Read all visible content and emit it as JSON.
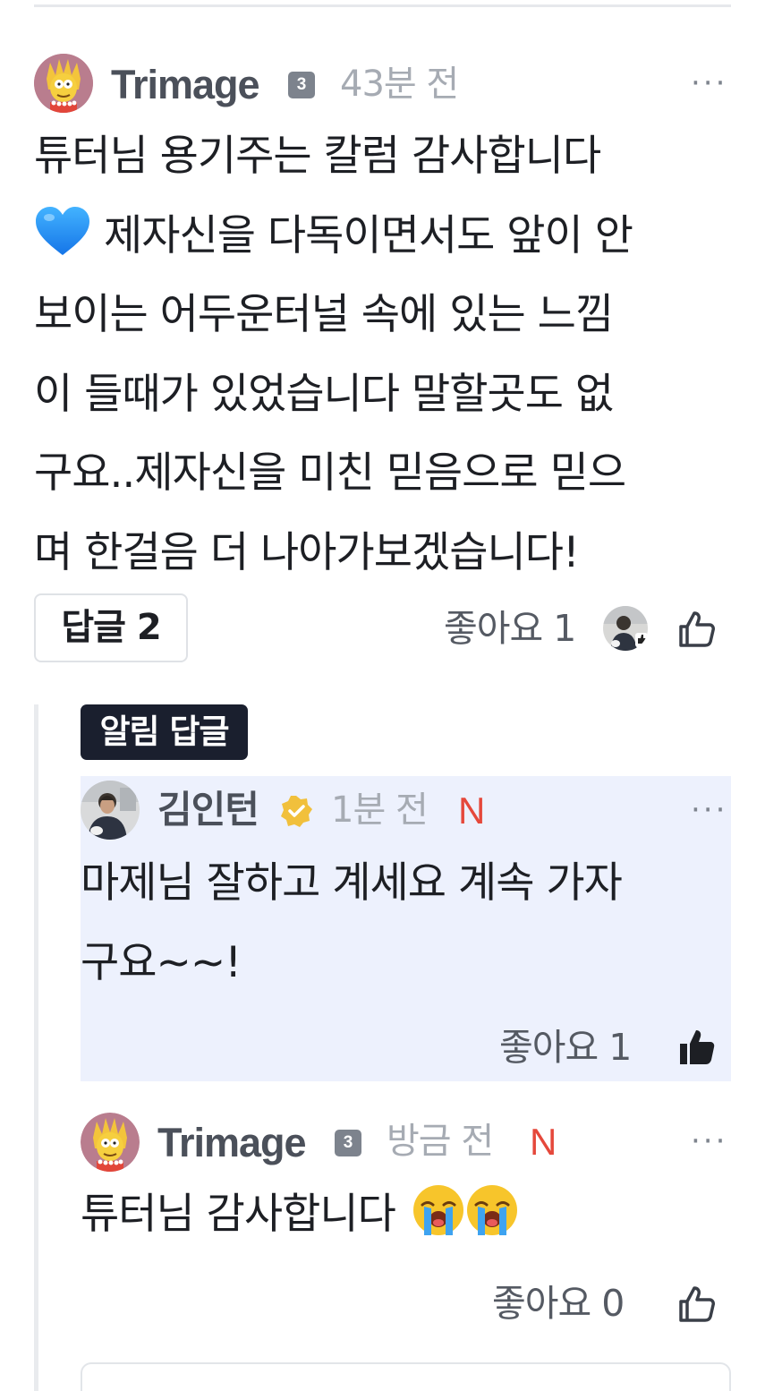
{
  "comment": {
    "author": "Trimage",
    "level": "3",
    "time": "43분 전",
    "more": "···",
    "lines": [
      "튜터님 용기주는 칼럼 감사합니다",
      "제자신을 다독이면서도 앞이 안",
      "보이는 어두운터널 속에 있는 느낌",
      "이 들때가 있었습니다 말할곳도 없",
      "구요..제자신을 미친 믿음으로 믿으",
      "며 한걸음 더 나아가보겠습니다!"
    ],
    "heart_icon": "blue-heart-icon",
    "reply_button": "답글 2",
    "like_label": "좋아요 1"
  },
  "notice_reply_tag": "알림 답글",
  "reply1": {
    "author": "김인턴",
    "time": "1분 전",
    "new_badge": "N",
    "more": "···",
    "lines": [
      "마제님 잘하고 계세요 계속 가자",
      "구요~~!"
    ],
    "like_label": "좋아요 1",
    "liked": true,
    "highlight_color": "#edf1fd"
  },
  "reply2": {
    "author": "Trimage",
    "level": "3",
    "time": "방금 전",
    "new_badge": "N",
    "more": "···",
    "text": "튜터님 감사합니다",
    "emoji_icon": "loudly-crying-face-icon",
    "like_label": "좋아요 0"
  },
  "colors": {
    "new_badge": "#e5483b",
    "notice_tag_bg": "#1a1f2e",
    "level_badge_bg": "#7d838d"
  }
}
